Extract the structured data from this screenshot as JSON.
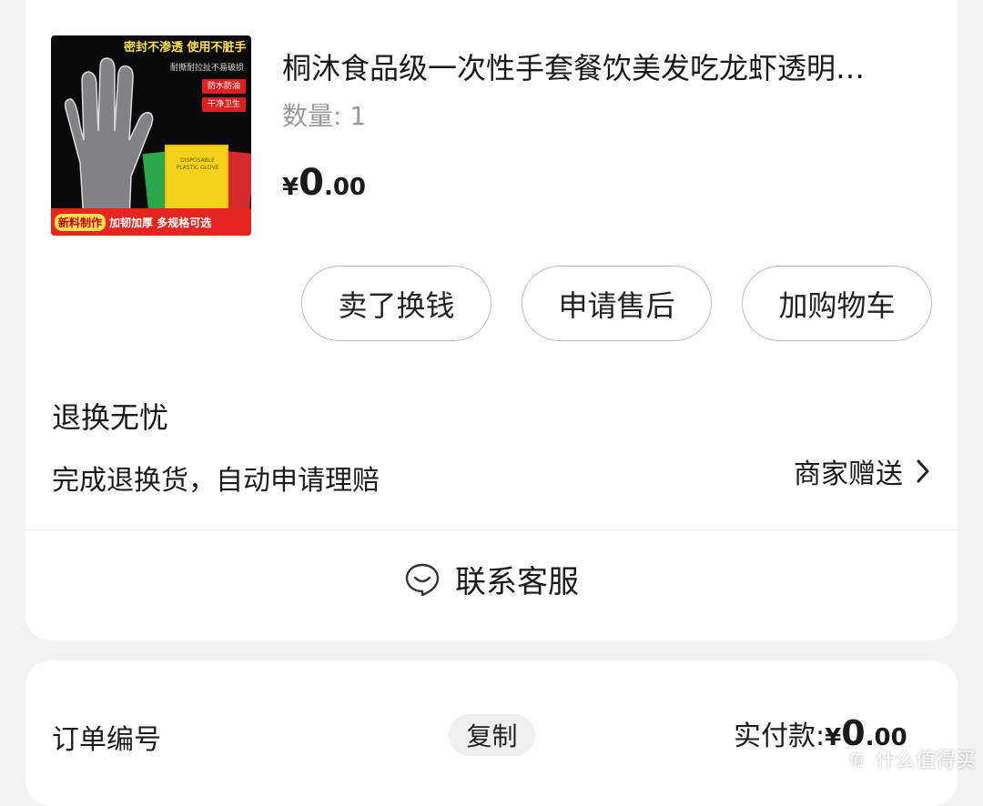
{
  "product": {
    "image_alt": "disposable-gloves-product-image",
    "image_text": {
      "top": "密封不渗透 使用不脏手",
      "sub": "耐撕耐拉扯不易破损",
      "tag1": "防水防油",
      "tag2": "干净卫生",
      "pack": "DISPOSABLE PLASTIC GLOVE",
      "bottom_pill": "新料制作",
      "bottom_text": "加韧加厚 多规格可选"
    },
    "title": "桐沐食品级一次性手套餐饮美发吃龙虾透明…",
    "quantity": "数量: 1",
    "price_symbol": "¥",
    "price_int": "0",
    "price_dec": ".00"
  },
  "actions": {
    "sell": "卖了换钱",
    "after_sale": "申请售后",
    "add_cart": "加购物车"
  },
  "guarantee": {
    "title": "退换无忧",
    "desc": "完成退换货，自动申请理赔",
    "gift_label": "商家赠送"
  },
  "contact": {
    "label": "联系客服"
  },
  "order": {
    "number_label": "订单编号",
    "copy_label": "复制",
    "paid_label": "实付款:",
    "paid_symbol": "¥",
    "paid_int": "0",
    "paid_dec": ".00"
  },
  "watermark": {
    "text": "什么值得买",
    "icon_text": "值"
  },
  "colors": {
    "background": "#f2f2f2",
    "card": "#ffffff",
    "button_border": "#bdbdbd",
    "muted_text": "#999999",
    "copy_bg": "#efefef"
  }
}
